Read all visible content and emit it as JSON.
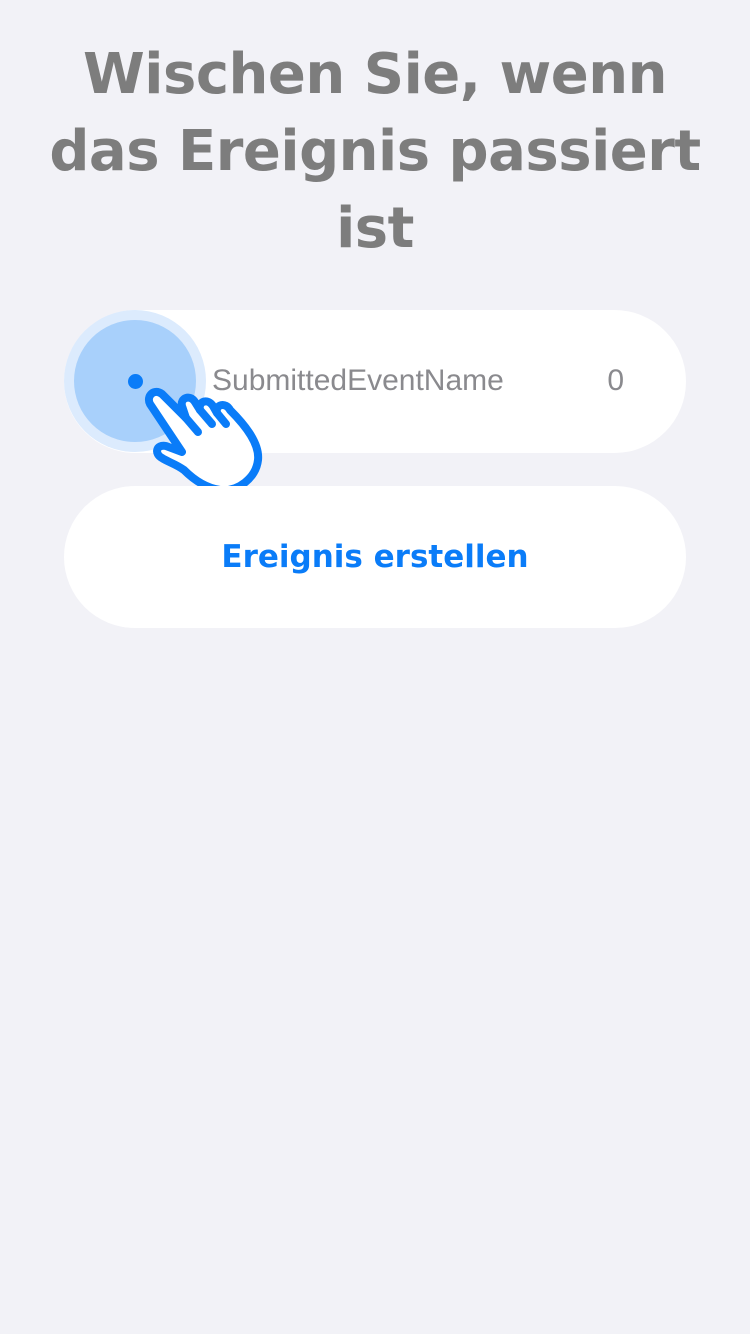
{
  "header": {
    "title": "Wischen Sie, wenn das Ereignis passiert ist"
  },
  "event": {
    "name": "SubmittedEventName",
    "count": "0",
    "swipe_handle_icon": "dot-icon",
    "gesture_icon": "pointing-hand-icon"
  },
  "actions": {
    "create_label": "Ereignis erstellen"
  },
  "colors": {
    "background": "#f2f2f7",
    "card": "#ffffff",
    "accent": "#0a7cf8",
    "handle": "#a8d0fb",
    "title": "#7d7d7d",
    "secondary_text": "#8a8a8e"
  }
}
